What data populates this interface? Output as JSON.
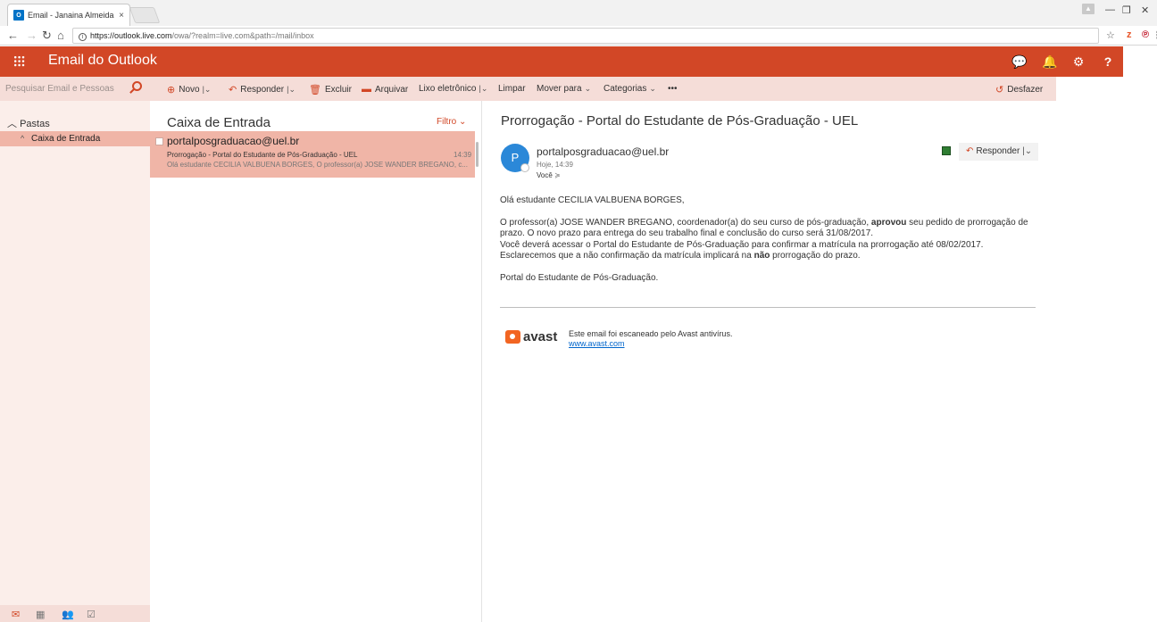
{
  "browser": {
    "tab_title": "Email - Janaina Almeida",
    "tab_close": "×",
    "url_host": "https://outlook.live.com",
    "url_rest": "/owa/?realm=live.com&path=/mail/inbox"
  },
  "suite": {
    "app_name": "Email do Outlook"
  },
  "search": {
    "placeholder": "Pesquisar Email e Pessoas"
  },
  "commands": {
    "novo": "Novo",
    "responder": "Responder",
    "excluir": "Excluir",
    "arquivar": "Arquivar",
    "lixo": "Lixo eletrônico",
    "limpar": "Limpar",
    "mover": "Mover para",
    "categorias": "Categorias",
    "more": "•••",
    "desfazer": "Desfazer"
  },
  "folders": {
    "header": "Pastas",
    "items": [
      {
        "label": "Caixa de Entrada"
      }
    ]
  },
  "list": {
    "title": "Caixa de Entrada",
    "filter": "Filtro",
    "messages": [
      {
        "from": "portalposgraduacao@uel.br",
        "subject": "Prorrogação - Portal do Estudante de Pós-Graduação - UEL",
        "time": "14:39",
        "preview": "Olá estudante CECILIA VALBUENA BORGES, O professor(a) JOSE WANDER BREGANO, c..."
      }
    ]
  },
  "reading": {
    "subject": "Prorrogação - Portal do Estudante de Pós-Graduação - UEL",
    "avatar_initial": "P",
    "sender": "portalposgraduacao@uel.br",
    "sent": "Hoje, 14:39",
    "to": "Você",
    "reply_label": "Responder",
    "greeting": "Olá estudante CECILIA VALBUENA BORGES,",
    "para1_a": "O professor(a) JOSE WANDER BREGANO, coordenador(a) do seu curso de pós-graduação, ",
    "para1_bold": "aprovou",
    "para1_b": " seu pedido de prorrogação de prazo. O novo prazo para entrega do seu trabalho final e conclusão do curso será 31/08/2017.",
    "para2_a": "Você deverá acessar o Portal do Estudante de Pós-Graduação para confirmar a matrícula na prorrogação até 08/02/2017. Esclarecemos que a não confirmação da matrícula implicará na ",
    "para2_bold": "não",
    "para2_b": " prorrogação do prazo.",
    "signature": "Portal do Estudante de Pós-Graduação.",
    "avast_word": "avast",
    "avast_text": "Este email foi escaneado pelo Avast antivírus.",
    "avast_link": "www.avast.com"
  },
  "colors": {
    "brand": "#d24726",
    "selected_row": "#f0b5a7",
    "cmdbar": "#f5ddd8"
  }
}
